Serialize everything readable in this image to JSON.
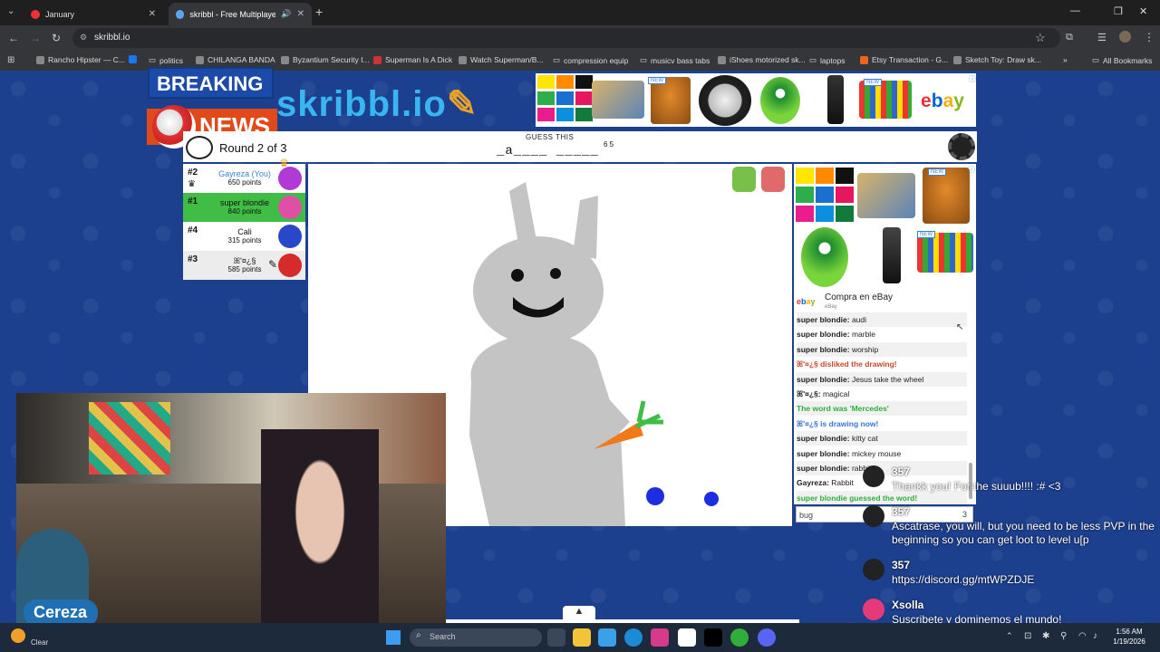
{
  "browser": {
    "tabs": [
      {
        "title": "January",
        "active": false
      },
      {
        "title": "skribbl - Free Multiplayer D",
        "active": true
      }
    ],
    "url": "skribbl.io",
    "bookmarks": [
      "Rancho Hipster — C...",
      "politics",
      "CHILANGA BANDA",
      "Byzantium Security I...",
      "Superman Is A Dick",
      "Watch Superman/B...",
      "compression equip",
      "musicv bass tabs",
      "iShoes motorized sk...",
      "laptops",
      "Etsy Transaction - G...",
      "Sketch Toy: Draw sk..."
    ],
    "all_bookmarks": "All Bookmarks"
  },
  "overlay": {
    "breaking": "BREAKING",
    "news": "NEWS"
  },
  "logo": {
    "text": "skribbl.io"
  },
  "game": {
    "round_text": "Round 2 of 3",
    "guess_label": "GUESS THIS",
    "word_hint": "_a____ _____",
    "word_lengths": "6 5",
    "input_value": "bug",
    "input_count": "3",
    "players": [
      {
        "rank": "#2",
        "name": "Gayreza (You)",
        "points": "650 points",
        "you": true,
        "drawing": false,
        "color": "#b13ad6"
      },
      {
        "rank": "#1",
        "name": "super blondie",
        "points": "840 points",
        "you": false,
        "drawing": false,
        "highlight": true,
        "color": "#e04fa6"
      },
      {
        "rank": "#4",
        "name": "Cali",
        "points": "315 points",
        "you": false,
        "drawing": false,
        "color": "#2948c9"
      },
      {
        "rank": "#3",
        "name": "ꕤ'¤¿§",
        "points": "585 points",
        "you": false,
        "drawing": true,
        "color": "#d62b2b"
      }
    ]
  },
  "ads": {
    "ebay_text": "Compra en eBay",
    "ebay_sub": "eBay",
    "new_badge": "NEW"
  },
  "chat": [
    {
      "user": "super blondie:",
      "text": "audi",
      "color": "#222",
      "kind": "normal"
    },
    {
      "user": "super blondie:",
      "text": "marble",
      "color": "#222",
      "kind": "normal"
    },
    {
      "user": "super blondie:",
      "text": "worship",
      "color": "#222",
      "kind": "normal"
    },
    {
      "user": "",
      "text": "ꕤ'¤¿§ disliked the drawing!",
      "color": "#c8472b",
      "kind": "system"
    },
    {
      "user": "super blondie:",
      "text": "Jesus take the wheel",
      "color": "#222",
      "kind": "normal"
    },
    {
      "user": "ꕤ'¤¿§:",
      "text": "magical",
      "color": "#222",
      "kind": "normal"
    },
    {
      "user": "",
      "text": "The word was 'Mercedes'",
      "color": "#2fae3b",
      "kind": "system"
    },
    {
      "user": "",
      "text": "ꕤ'¤¿§ is drawing now!",
      "color": "#3a72d8",
      "kind": "system"
    },
    {
      "user": "super blondie:",
      "text": "kitty cat",
      "color": "#222",
      "kind": "normal"
    },
    {
      "user": "super blondie:",
      "text": "mickey mouse",
      "color": "#222",
      "kind": "normal"
    },
    {
      "user": "super blondie:",
      "text": "rabbit",
      "color": "#222",
      "kind": "normal"
    },
    {
      "user": "Gayreza:",
      "text": "Rabbit",
      "color": "#222",
      "kind": "normal"
    },
    {
      "user": "",
      "text": "super blondie guessed the word!",
      "color": "#2fae3b",
      "kind": "system"
    }
  ],
  "webcam": {
    "name": "Cereza"
  },
  "stream_chat": [
    {
      "user": "357",
      "text": "Thankk you! For the suuub!!!! :# <3"
    },
    {
      "user": "357",
      "text": "Ascatrase, you will, but you need to be less PVP in the beginning so you can get loot to level u[p"
    },
    {
      "user": "357",
      "text": "https://discord.gg/mtWPZDJE"
    },
    {
      "user": "Xsolla",
      "text": "Suscribete y dominemos el mundo!"
    }
  ],
  "taskbar": {
    "clear": "Clear",
    "search": "Search",
    "time": "1:56 AM",
    "date": "1/19/2026"
  },
  "colors": {
    "page_bg": "#1c3f8e",
    "accent_green": "#3fbd44",
    "ebay": "#e53238"
  }
}
